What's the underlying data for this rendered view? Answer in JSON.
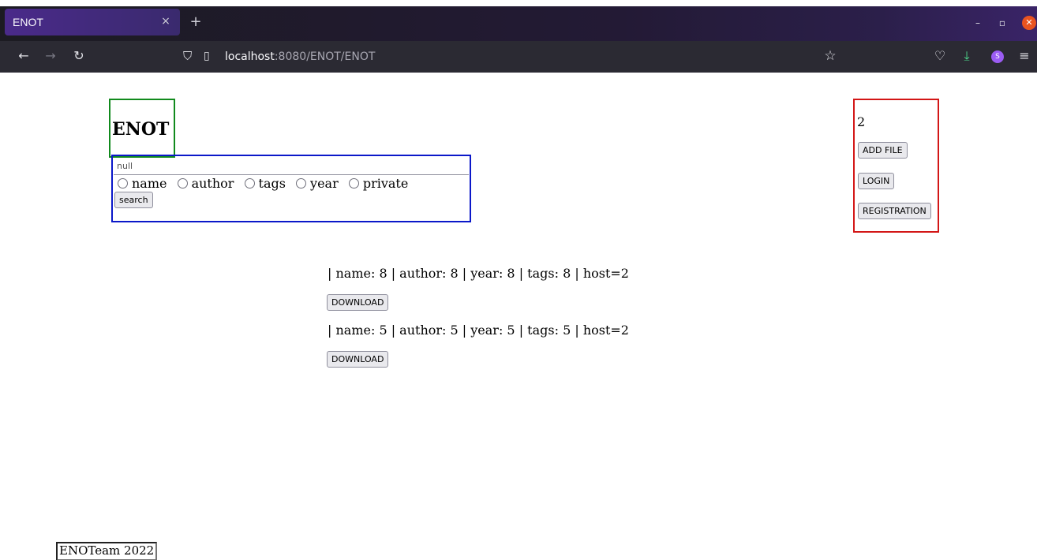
{
  "browser": {
    "tab_title": "ENOT",
    "tab_close": "×",
    "new_tab": "+",
    "url_host": "localhost",
    "url_rest": ":8080/ENOT/ENOT",
    "account_initial": "S"
  },
  "header": {
    "title": "ENOT"
  },
  "search": {
    "input_value": "null",
    "options": [
      "name",
      "author",
      "tags",
      "year",
      "private"
    ],
    "button_label": "search"
  },
  "user_panel": {
    "count": "2",
    "add_file_label": "ADD FILE",
    "login_label": "LOGIN",
    "registration_label": "REGISTRATION"
  },
  "results": [
    {
      "text": "| name: 8 | author: 8 | year: 8 | tags: 8 | host=2",
      "download_label": "DOWNLOAD"
    },
    {
      "text": "| name: 5 | author: 5 | year: 5 | tags: 5 | host=2",
      "download_label": "DOWNLOAD"
    }
  ],
  "footer": {
    "text": "ENOTeam 2022"
  },
  "colors": {
    "logo_border": "#118a1d",
    "search_border": "#0b18c9",
    "user_border": "#d31616"
  }
}
